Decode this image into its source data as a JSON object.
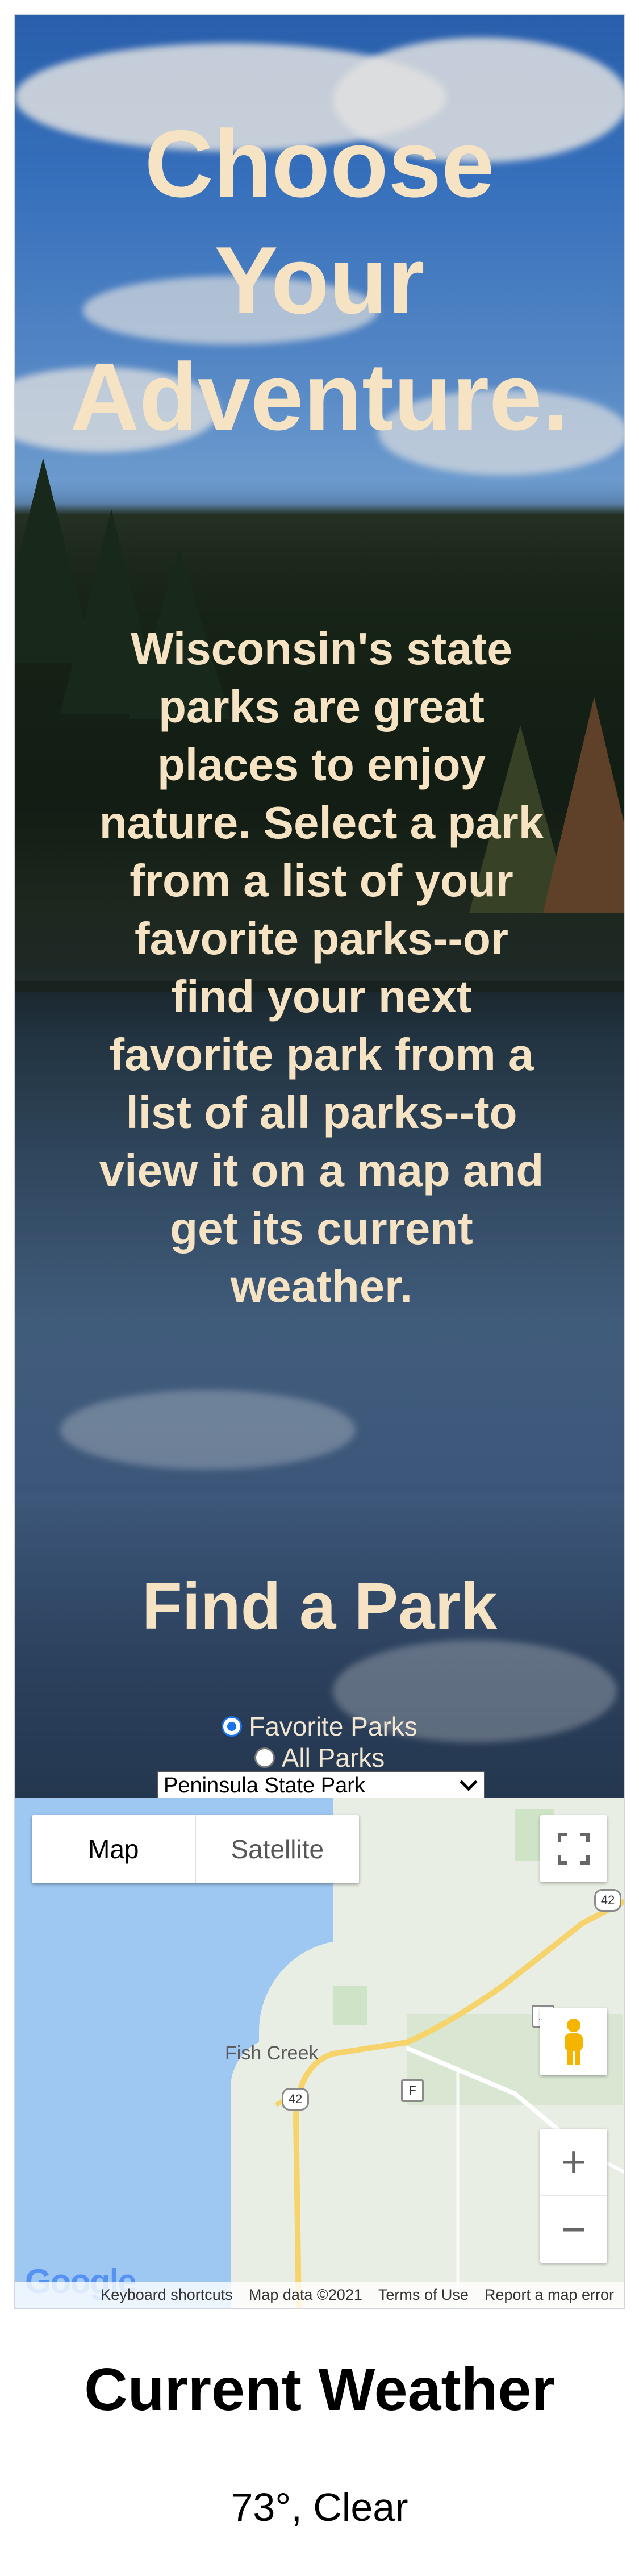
{
  "hero": {
    "title": "Choose Your Adventure.",
    "blurb": "Wisconsin's state parks are great places to enjoy nature. Select a park from a list of your favorite parks--or find your next favorite park from a list of all parks--to view it on a map and get its current weather."
  },
  "finder": {
    "heading": "Find a Park",
    "options": [
      {
        "label": "Favorite Parks",
        "selected": true
      },
      {
        "label": "All Parks",
        "selected": false
      }
    ],
    "selected_park": "Peninsula State Park"
  },
  "map": {
    "map_type_buttons": [
      "Map",
      "Satellite"
    ],
    "active_map_type": "Map",
    "place_labels": [
      "Fish Creek"
    ],
    "road_shields": [
      "42",
      "42",
      "F",
      "A"
    ],
    "zoom_in_symbol": "+",
    "zoom_out_symbol": "−",
    "logo_text": "Google",
    "attribution": [
      "Keyboard shortcuts",
      "Map data ©2021",
      "Terms of Use",
      "Report a map error"
    ],
    "colors": {
      "water": "#9ec7f2",
      "land": "#e8eee4",
      "road": "#f7d36b"
    }
  },
  "weather": {
    "heading": "Current Weather",
    "value": "73°, Clear"
  },
  "colors": {
    "hero_text": "#f6e3c4",
    "radio_accent": "#1a73e8"
  }
}
